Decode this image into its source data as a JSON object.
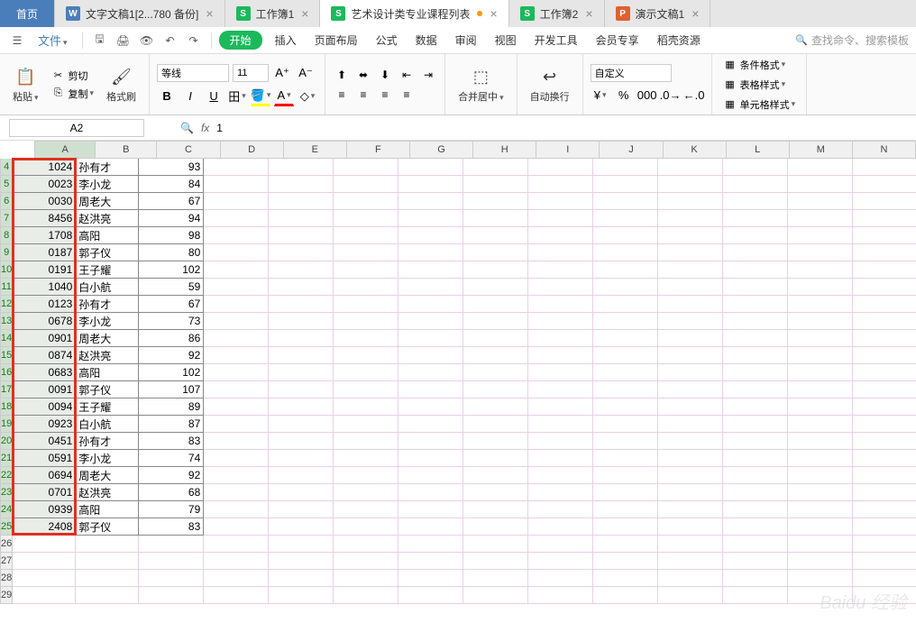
{
  "tabs": {
    "home": "首页",
    "items": [
      {
        "icon": "W",
        "color": "#4a7ebb",
        "label": "文字文稿1[2...780 备份]",
        "active": false
      },
      {
        "icon": "S",
        "color": "#1cb95c",
        "label": "工作簿1",
        "active": false
      },
      {
        "icon": "S",
        "color": "#1cb95c",
        "label": "艺术设计类专业课程列表",
        "active": true,
        "dot": true
      },
      {
        "icon": "S",
        "color": "#1cb95c",
        "label": "工作簿2",
        "active": false
      },
      {
        "icon": "P",
        "color": "#e06030",
        "label": "演示文稿1",
        "active": false
      }
    ]
  },
  "menu": {
    "file": "文件",
    "start": "开始",
    "items": [
      "插入",
      "页面布局",
      "公式",
      "数据",
      "审阅",
      "视图",
      "开发工具",
      "会员专享",
      "稻壳资源"
    ],
    "search_placeholder": "查找命令、搜索模板"
  },
  "ribbon": {
    "paste": "粘贴",
    "cut": "剪切",
    "copy": "复制",
    "format_painter": "格式刷",
    "font_name": "等线",
    "font_size": "11",
    "merge": "合并居中",
    "wrap": "自动换行",
    "number_format": "自定义",
    "cond_fmt": "条件格式",
    "table_style": "表格样式",
    "cell_style": "单元格样式"
  },
  "namebox": "A2",
  "formula": "1",
  "columns": [
    "A",
    "B",
    "C",
    "D",
    "E",
    "F",
    "G",
    "H",
    "I",
    "J",
    "K",
    "L",
    "M",
    "N"
  ],
  "row_start": 4,
  "row_end": 29,
  "selected_rows": [
    4,
    25
  ],
  "chart_data": {
    "type": "table",
    "columns": [
      "A",
      "B",
      "C"
    ],
    "rows": [
      {
        "r": 4,
        "a": "1024",
        "b": "孙有才",
        "c": 93
      },
      {
        "r": 5,
        "a": "0023",
        "b": "李小龙",
        "c": 84
      },
      {
        "r": 6,
        "a": "0030",
        "b": "周老大",
        "c": 67
      },
      {
        "r": 7,
        "a": "8456",
        "b": "赵洪亮",
        "c": 94
      },
      {
        "r": 8,
        "a": "1708",
        "b": "高阳",
        "c": 98
      },
      {
        "r": 9,
        "a": "0187",
        "b": "郭子仪",
        "c": 80
      },
      {
        "r": 10,
        "a": "0191",
        "b": "王子耀",
        "c": 102
      },
      {
        "r": 11,
        "a": "1040",
        "b": "白小航",
        "c": 59
      },
      {
        "r": 12,
        "a": "0123",
        "b": "孙有才",
        "c": 67
      },
      {
        "r": 13,
        "a": "0678",
        "b": "李小龙",
        "c": 73
      },
      {
        "r": 14,
        "a": "0901",
        "b": "周老大",
        "c": 86
      },
      {
        "r": 15,
        "a": "0874",
        "b": "赵洪亮",
        "c": 92
      },
      {
        "r": 16,
        "a": "0683",
        "b": "高阳",
        "c": 102
      },
      {
        "r": 17,
        "a": "0091",
        "b": "郭子仪",
        "c": 107
      },
      {
        "r": 18,
        "a": "0094",
        "b": "王子耀",
        "c": 89
      },
      {
        "r": 19,
        "a": "0923",
        "b": "白小航",
        "c": 87
      },
      {
        "r": 20,
        "a": "0451",
        "b": "孙有才",
        "c": 83
      },
      {
        "r": 21,
        "a": "0591",
        "b": "李小龙",
        "c": 74
      },
      {
        "r": 22,
        "a": "0694",
        "b": "周老大",
        "c": 92
      },
      {
        "r": 23,
        "a": "0701",
        "b": "赵洪亮",
        "c": 68
      },
      {
        "r": 24,
        "a": "0939",
        "b": "高阳",
        "c": 79
      },
      {
        "r": 25,
        "a": "2408",
        "b": "郭子仪",
        "c": 83
      }
    ]
  },
  "watermark": "Baidu 经验"
}
